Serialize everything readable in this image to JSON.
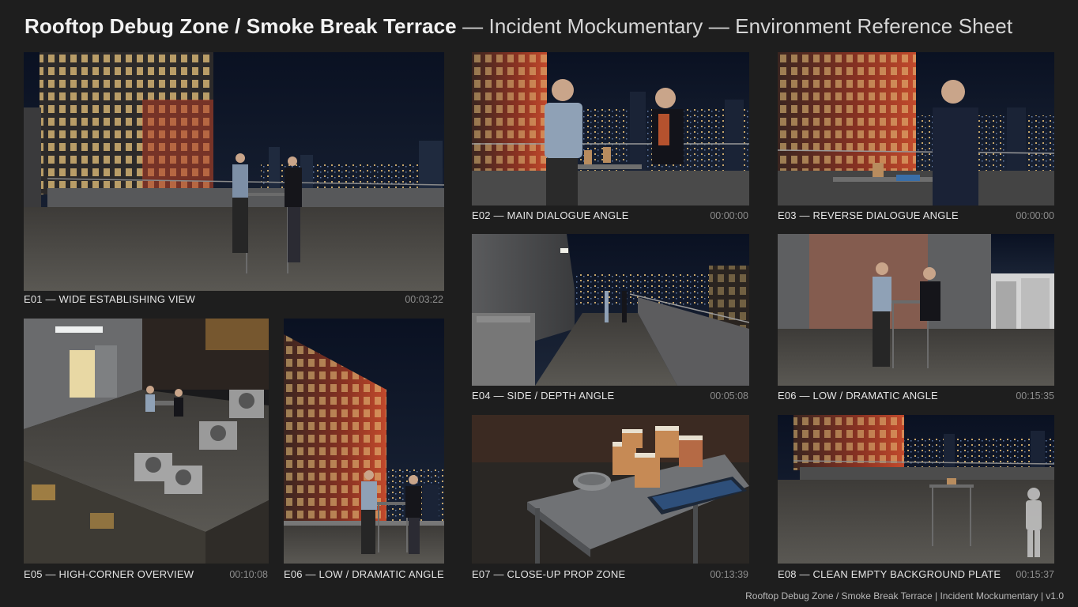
{
  "header": {
    "title_main": "Rooftop Debug Zone / Smoke Break Terrace",
    "title_sub": " — Incident Mockumentary — Environment Reference Sheet"
  },
  "frames": [
    {
      "label": "E01 — WIDE ESTABLISHING VIEW",
      "timecode": "00:03:22"
    },
    {
      "label": "E02 — MAIN DIALOGUE ANGLE",
      "timecode": "00:00:00"
    },
    {
      "label": "E03 — REVERSE DIALOGUE ANGLE",
      "timecode": "00:00:00"
    },
    {
      "label": "E04 — SIDE / DEPTH ANGLE",
      "timecode": "00:05:08"
    },
    {
      "label": "E06 — LOW / DRAMATIC ANGLE",
      "timecode": "00:15:35"
    },
    {
      "label": "E05 — HIGH-CORNER OVERVIEW",
      "timecode": "00:10:08"
    },
    {
      "label": "E06 — LOW / DRAMATIC ANGLE",
      "timecode": ""
    },
    {
      "label": "E07 — CLOSE-UP PROP ZONE",
      "timecode": "00:13:39"
    },
    {
      "label": "E08 — CLEAN EMPTY BACKGROUND PLATE",
      "timecode": "00:15:37"
    }
  ],
  "footer": "Rooftop Debug Zone / Smoke Break Terrace | Incident Mockumentary | v1.0",
  "colors": {
    "background": "#1e1e1e",
    "night_sky": "#0d1526",
    "building_glow": "#c0432a",
    "gravel": "#4a4844"
  }
}
